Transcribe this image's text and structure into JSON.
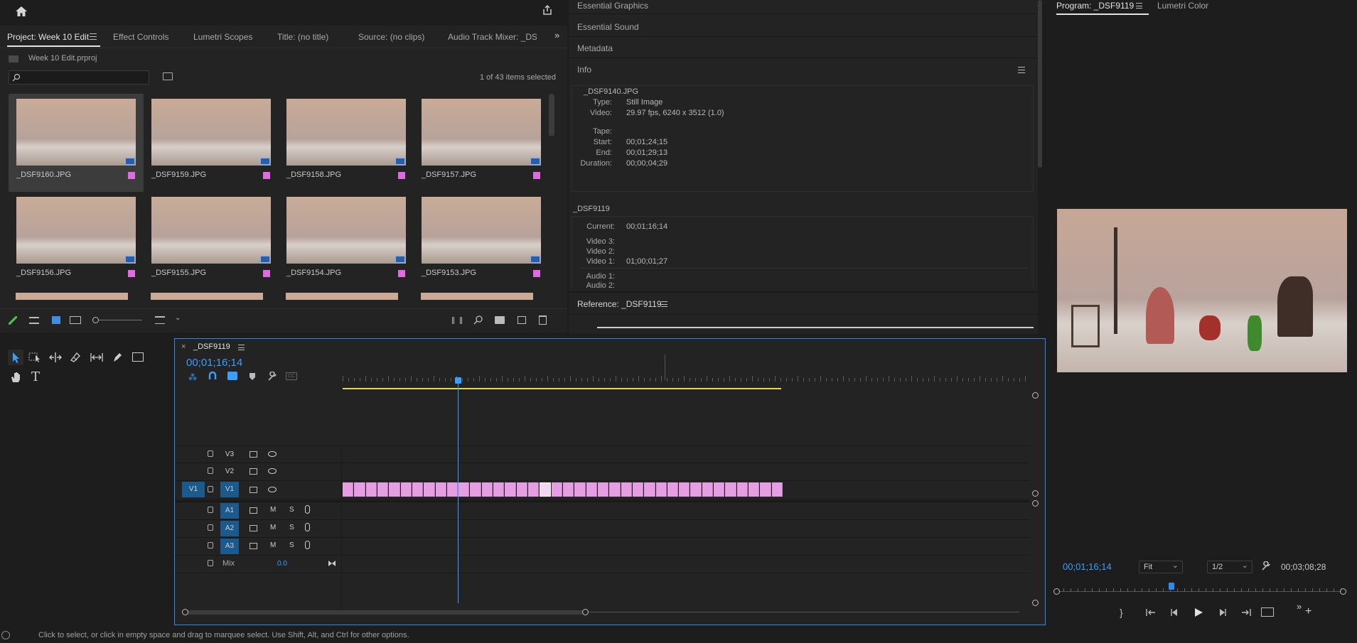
{
  "project_panel": {
    "tabs": [
      "Project: Week 10 Edit",
      "Effect Controls",
      "Lumetri Scopes",
      "Title: (no title)",
      "Source: (no clips)",
      "Audio Track Mixer: _DSF9"
    ],
    "project_file": "Week 10 Edit.prproj",
    "search_placeholder": "",
    "selection_count": "1 of 43 items selected",
    "thumbnails": [
      {
        "name": "_DSF9160.JPG",
        "selected": true
      },
      {
        "name": "_DSF9159.JPG",
        "selected": false
      },
      {
        "name": "_DSF9158.JPG",
        "selected": false
      },
      {
        "name": "_DSF9157.JPG",
        "selected": false
      },
      {
        "name": "_DSF9156.JPG",
        "selected": false
      },
      {
        "name": "_DSF9155.JPG",
        "selected": false
      },
      {
        "name": "_DSF9154.JPG",
        "selected": false
      },
      {
        "name": "_DSF9153.JPG",
        "selected": false
      }
    ],
    "label_color": "#e06bde"
  },
  "right_panels": {
    "essential_graphics": "Essential Graphics",
    "essential_sound": "Essential Sound",
    "metadata": "Metadata",
    "info_title": "Info",
    "info": {
      "clip_name": "_DSF9140.JPG",
      "type_label": "Type:",
      "type_value": "Still Image",
      "video_label": "Video:",
      "video_value": "29.97 fps, 6240 x 3512 (1.0)",
      "tape_label": "Tape:",
      "tape_value": "",
      "start_label": "Start:",
      "start_value": "00;01;24;15",
      "end_label": "End:",
      "end_value": "00;01;29;13",
      "duration_label": "Duration:",
      "duration_value": "00;00;04;29"
    },
    "sequence_info": {
      "name": "_DSF9119",
      "current_label": "Current:",
      "current_value": "00;01;16;14",
      "video3_label": "Video 3:",
      "video3_value": "",
      "video2_label": "Video 2:",
      "video2_value": "",
      "video1_label": "Video 1:",
      "video1_value": "01;00;01;27",
      "audio1_label": "Audio 1:",
      "audio1_value": "",
      "audio2_label": "Audio 2:",
      "audio2_value": ""
    },
    "reference_tab": "Reference: _DSF9119"
  },
  "program_monitor": {
    "tabs": [
      "Program: _DSF9119",
      "Lumetri Color"
    ],
    "current_time": "00;01;16;14",
    "fit": "Fit",
    "resolution": "1/2",
    "duration": "00;03;08;28",
    "playhead_fraction": 0.4
  },
  "timeline": {
    "sequence_tab": "_DSF9119",
    "timecode": "00;01;16;14",
    "tracks": {
      "video": [
        {
          "label": "V3",
          "targeted": false
        },
        {
          "label": "V2",
          "targeted": false
        },
        {
          "label": "V1",
          "targeted": true,
          "source": "V1"
        }
      ],
      "audio": [
        {
          "label": "A1",
          "m": "M",
          "s": "S"
        },
        {
          "label": "A2",
          "m": "M",
          "s": "S"
        },
        {
          "label": "A3",
          "m": "M",
          "s": "S"
        }
      ],
      "mix_label": "Mix",
      "mix_value": "0.0"
    },
    "clip_count": 38,
    "clip_color": "#e59ee1",
    "accent_color": "#2d8ceb"
  },
  "status_bar": {
    "text": "Click to select, or click in empty space and drag to marquee select. Use Shift, Alt, and Ctrl for other options."
  },
  "icons": [
    "home-icon",
    "share-icon",
    "search-icon",
    "selection-tool-icon",
    "track-select-icon",
    "ripple-edit-icon",
    "razor-icon",
    "slip-icon",
    "pen-icon",
    "rectangle-icon",
    "hand-icon",
    "type-icon",
    "play-icon",
    "wrench-icon"
  ]
}
